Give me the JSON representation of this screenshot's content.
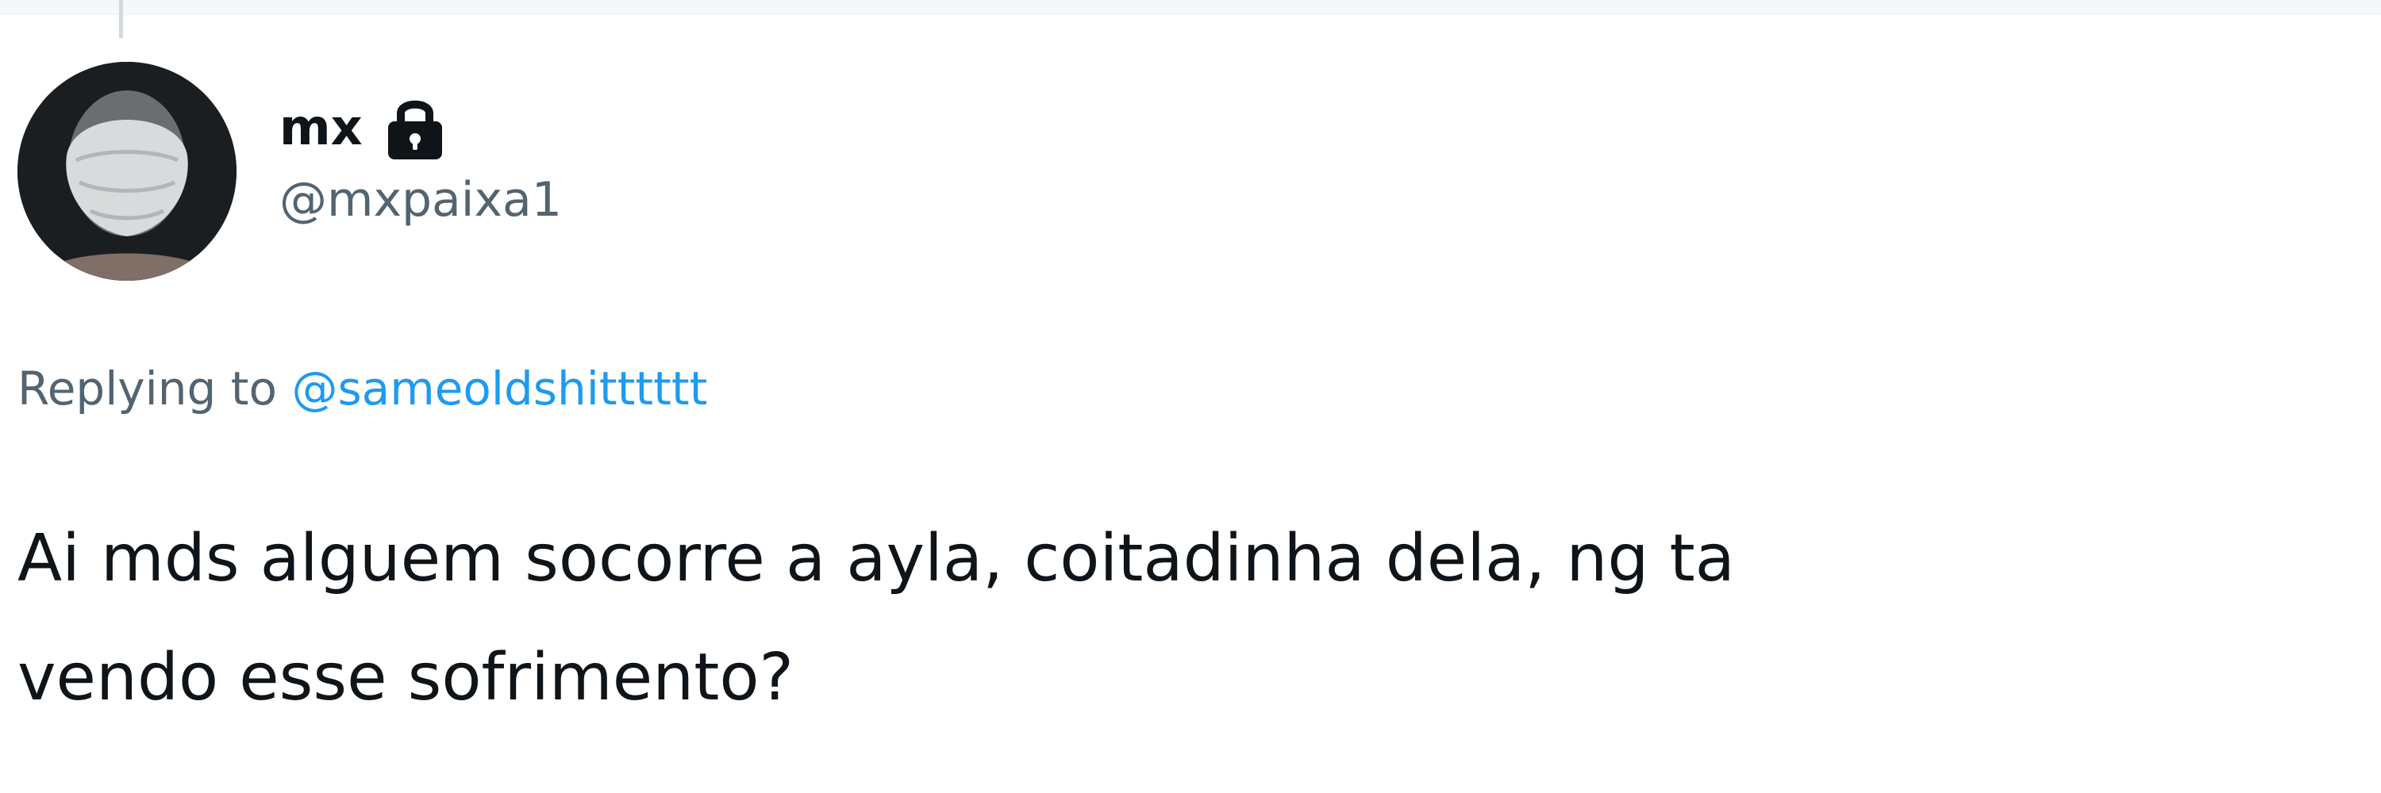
{
  "tweet": {
    "author": {
      "display_name": "mx",
      "handle": "@mxpaixa1",
      "protected_icon": "lock-icon",
      "avatar_icon": "masked-face-avatar"
    },
    "reply": {
      "prefix": "Replying to",
      "to_handle": "@sameoldshitttttt"
    },
    "text_lines": [
      "Ai mds alguem socorre a ayla, coitadinha dela, ng ta",
      "vendo esse sofrimento?"
    ]
  },
  "colors": {
    "text_primary": "#0f1419",
    "text_secondary": "#536471",
    "link": "#1d9bf0",
    "background": "#ffffff"
  }
}
